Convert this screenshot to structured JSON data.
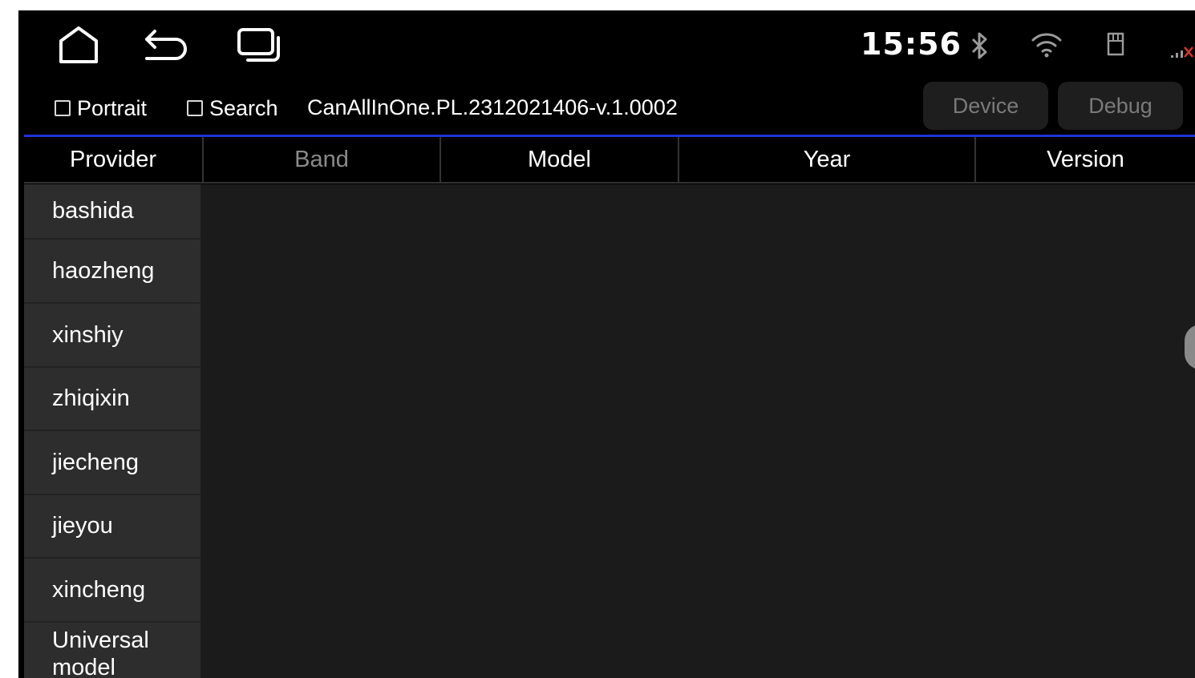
{
  "status_bar": {
    "time": "15:56",
    "icons": [
      "home-icon",
      "back-icon",
      "recent-apps-icon",
      "bluetooth-icon",
      "wifi-icon",
      "sd-card-icon",
      "signal-icon"
    ]
  },
  "toolbar": {
    "portrait_label": "Portrait",
    "portrait_checked": false,
    "search_label": "Search",
    "search_checked": false,
    "version": "CanAllInOne.PL.2312021406-v.1.0002",
    "device_label": "Device",
    "debug_label": "Debug"
  },
  "table": {
    "columns": [
      "Provider",
      "Band",
      "Model",
      "Year",
      "Version"
    ]
  },
  "providers": [
    "bashida",
    "haozheng",
    "xinshiy",
    "zhiqixin",
    "jiecheng",
    "jieyou",
    "xincheng",
    "Universal model"
  ],
  "colors": {
    "accent_line": "#1f33d6",
    "background": "#1b1b1b",
    "list_item": "#2d2d2d",
    "signal_accent": "#e03030"
  }
}
